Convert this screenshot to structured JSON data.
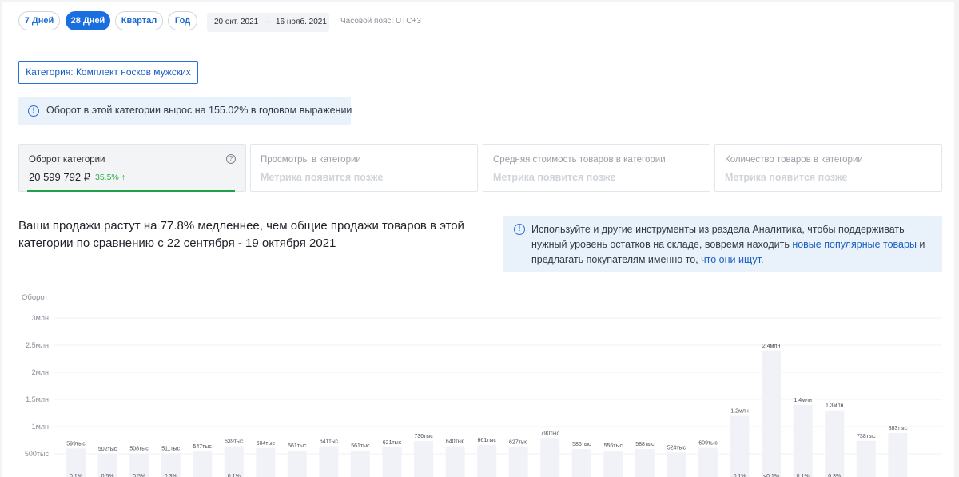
{
  "toolbar": {
    "periods": [
      {
        "label": "7 Дней",
        "active": false
      },
      {
        "label": "28 Дней",
        "active": true
      },
      {
        "label": "Квартал",
        "active": false
      },
      {
        "label": "Год",
        "active": false
      }
    ],
    "date_from": "20 окт. 2021",
    "date_sep": "–",
    "date_to": "16 нояб. 2021",
    "timezone": "Часовой пояс: UTC+3"
  },
  "category_button": "Категория: Комплект носков мужских",
  "notice": "Оборот в этой категории вырос на 155.02% в годовом выражении",
  "metrics": [
    {
      "title": "Оборот категории",
      "value": "20 599 792 ₽",
      "delta": "35.5% ↑",
      "active": true
    },
    {
      "title": "Просмотры в категории",
      "placeholder": "Метрика появится позже",
      "active": false
    },
    {
      "title": "Средняя стоимость товаров в категории",
      "placeholder": "Метрика появится позже",
      "active": false
    },
    {
      "title": "Количество товаров в категории",
      "placeholder": "Метрика появится позже",
      "active": false
    }
  ],
  "headline": "Ваши продажи растут на 77.8% медленнее, чем общие продажи товаров в этой категории по сравнению с 22 сентября - 19 октября 2021",
  "tip": {
    "text_before": "Используйте и другие инструменты из раздела Аналитика, чтобы поддерживать нужный уровень остатков на складе, вовремя находить ",
    "link1": "новые популярные товары",
    "text_middle": " и предлагать покупателям именно то, ",
    "link2": "что они ищут",
    "text_after": "."
  },
  "colors": {
    "accent": "#1a6fe0",
    "positive": "#2fa84f",
    "bar": "#f1f2f7",
    "info_bg": "#e9f1fb"
  },
  "chart_data": {
    "type": "bar",
    "ylabel": "Оборот",
    "yticks": [
      "500тыс",
      "1млн",
      "1.5млн",
      "2млн",
      "2.5млн",
      "3млн"
    ],
    "ytick_values": [
      500000,
      1000000,
      1500000,
      2000000,
      2500000,
      3000000
    ],
    "ylim": [
      0,
      3000000
    ],
    "grid": true,
    "values": [
      599000,
      502000,
      508000,
      511000,
      547000,
      639000,
      604000,
      561000,
      641000,
      561000,
      621000,
      736000,
      640000,
      661000,
      627000,
      790000,
      586000,
      556000,
      588000,
      524000,
      609000,
      1200000,
      2400000,
      1400000,
      1300000,
      738000,
      883000
    ],
    "value_labels": [
      "599тыс",
      "502тыс",
      "508тыс",
      "511тыс",
      "547тыс",
      "639тыс",
      "604тыс",
      "561тыс",
      "641тыс",
      "561тыс",
      "621тыс",
      "736тыс",
      "640тыс",
      "661тыс",
      "627тыс",
      "790тыс",
      "586тыс",
      "556тыс",
      "588тыс",
      "524тыс",
      "609тыс",
      "1.2млн",
      "2.4млн",
      "1.4млн",
      "1.3млн",
      "738тыс",
      "883тыс"
    ],
    "share_labels": [
      "0.1%",
      "0.5%",
      "0.5%",
      "0.3%",
      "",
      "0.1%",
      "",
      "",
      "",
      "",
      "",
      "",
      "",
      "",
      "",
      "",
      "",
      "",
      "",
      "",
      "",
      "0.1%",
      "<0.1%",
      "0.1%",
      "0.3%",
      "",
      ""
    ]
  }
}
